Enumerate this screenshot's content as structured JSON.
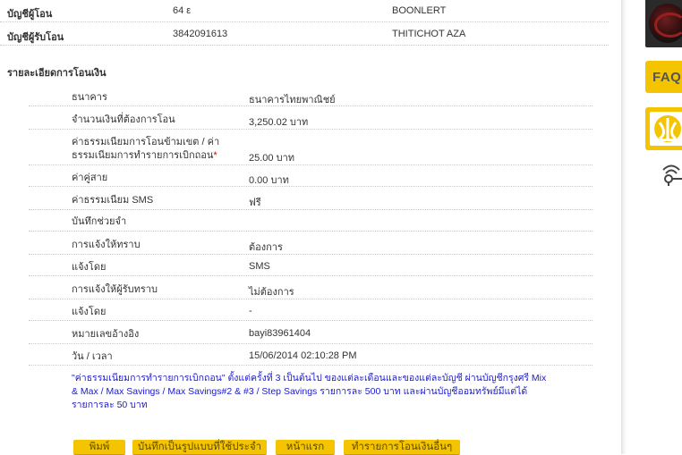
{
  "accounts": [
    {
      "label": "บัญชีผู้โอน",
      "number": "64          ε",
      "name": "BOONLERT"
    },
    {
      "label": "บัญชีผู้รับโอน",
      "number": "3842091613",
      "name": "THITICHOT AZA"
    }
  ],
  "section_title": "รายละเอียดการโอนเงิน",
  "details": [
    {
      "label": "ธนาคาร",
      "value": "ธนาคารไทยพาณิชย์"
    },
    {
      "label": "จำนวนเงินที่ต้องการโอน",
      "value": "3,250.02 บาท"
    },
    {
      "label": "ค่าธรรมเนียมการโอนข้ามเขต / ค่าธรรมเนียมการทำรายการเบิกถอน",
      "required_mark": "*",
      "value": "25.00 บาท"
    },
    {
      "label": "ค่าคู่สาย",
      "value": "0.00 บาท"
    },
    {
      "label": "ค่าธรรมเนียม SMS",
      "value": "ฟรี"
    },
    {
      "label": "บันทึกช่วยจำ",
      "value": ""
    },
    {
      "label": "การแจ้งให้ทราบ",
      "value": "ต้องการ"
    },
    {
      "label": "แจ้งโดย",
      "value": "SMS"
    },
    {
      "label": "การแจ้งให้ผู้รับทราบ",
      "value": "ไม่ต้องการ"
    },
    {
      "label": "แจ้งโดย",
      "value": "-"
    },
    {
      "label": "หมายเลขอ้างอิง",
      "value": "bayi83961404"
    },
    {
      "label": "วัน / เวลา",
      "value": "15/06/2014 02:10:28 PM"
    }
  ],
  "note": "\"ค่าธรรมเนียมการทำรายการเบิกถอน\" ตั้งแต่ครั้งที่ 3 เป็นต้นไป ของแต่ละเดือนและของแต่ละบัญชี ผ่านบัญชีกรุงศรี Mix & Max / Max Savings / Max Savings#2 & #3 / Step Savings รายการละ 500 บาท และผ่านบัญชีออมทรัพย์มีแต่ได้ รายการละ 50 บาท",
  "buttons": {
    "print": "พิมพ์",
    "save_template": "บันทึกเป็นรูปแบบที่ใช้ประจำ",
    "home": "หน้าแรก",
    "another_transfer": "ทำรายการโอนเงินอื่นๆ"
  },
  "sidebar": {
    "faq_label": "FAQ",
    "profile_icon": "profile-thumbnail",
    "bank_logo_icon": "krungsri-logo",
    "wifi_icon": "wireless-icon"
  },
  "colors": {
    "accent": "#f5c400",
    "note_text": "#1a1acc",
    "required": "#d00000"
  }
}
